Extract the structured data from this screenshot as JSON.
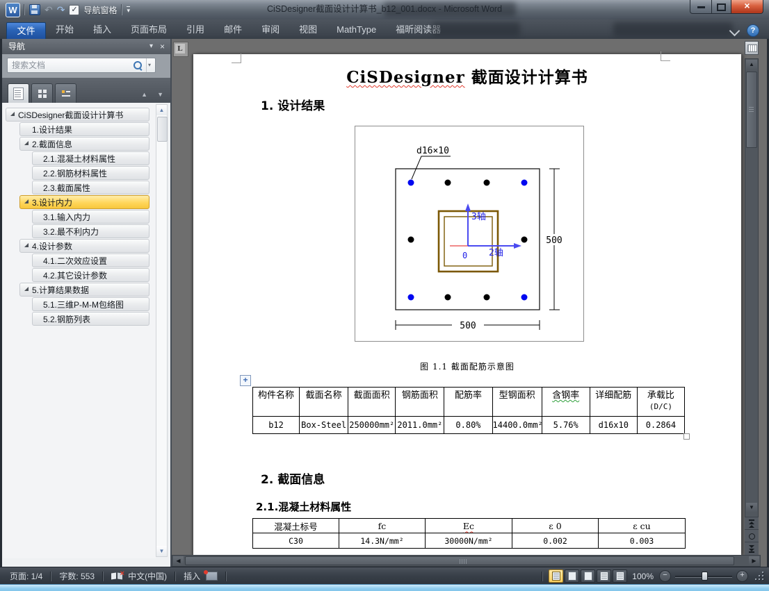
{
  "window": {
    "title": "CiSDesigner截面设计计算书_b12_001.docx  -  Microsoft Word",
    "qat_nav_checkbox_label": "导航窗格",
    "tabs": [
      "文件",
      "开始",
      "插入",
      "页面布局",
      "引用",
      "邮件",
      "审阅",
      "视图",
      "MathType",
      "福昕阅读器"
    ]
  },
  "icons": {
    "logo": "W",
    "undo": "↶",
    "redo": "↷",
    "checkbox_check": "✓",
    "qat_dropdown": "▾",
    "help": "?",
    "close": "×",
    "nav_dropdown": "▾",
    "nav_close": "×",
    "search_dropdown": "▾",
    "scroll_up": "▲",
    "scroll_down": "▼",
    "scroll_left": "◀",
    "scroll_right": "▶",
    "tab_selector": "L",
    "table_move": "+",
    "zoom_out": "−",
    "zoom_in": "+"
  },
  "nav": {
    "title": "导航",
    "search_placeholder": "搜索文档",
    "items": [
      {
        "label": "CiSDesigner截面设计计算书"
      },
      {
        "label": "1.设计结果"
      },
      {
        "label": "2.截面信息"
      },
      {
        "label": "2.1.混凝土材料属性"
      },
      {
        "label": "2.2.钢筋材料属性"
      },
      {
        "label": "2.3.截面属性"
      },
      {
        "label": "3.设计内力"
      },
      {
        "label": "3.1.输入内力"
      },
      {
        "label": "3.2.最不利内力"
      },
      {
        "label": "4.设计参数"
      },
      {
        "label": "4.1.二次效应设置"
      },
      {
        "label": "4.2.其它设计参数"
      },
      {
        "label": "5.计算结果数据"
      },
      {
        "label": "5.1.三维P-M-M包络图"
      },
      {
        "label": "5.2.钢筋列表"
      }
    ]
  },
  "document": {
    "title_en": "CiSDesigner",
    "title_cn": " 截面设计计算书",
    "section1": "1. 设计结果",
    "figure": {
      "rebar_label": "d16×10",
      "axis_vertical": "3轴",
      "axis_horizontal": "2轴",
      "origin": "0",
      "dim_right": "500",
      "dim_bottom": "500",
      "caption": "图 1.1 截面配筋示意图"
    },
    "table1": {
      "headers": [
        "构件名称",
        "截面名称",
        "截面面积",
        "钢筋面积",
        "配筋率",
        "型钢面积",
        "含钢率",
        "详细配筋",
        "承载比"
      ],
      "header9_sub": "(D/C)",
      "row": [
        "b12",
        "Box-Steel",
        "250000mm²",
        "2011.0mm²",
        "0.80%",
        "14400.0mm²",
        "5.76%",
        "d16x10",
        "0.2864"
      ]
    },
    "section2": "2. 截面信息",
    "section2_1": "2.1.混凝土材料属性",
    "table2": {
      "headers": [
        "混凝土标号",
        "fc",
        "Ec",
        "ε 0",
        "ε cu"
      ],
      "row": [
        "C30",
        "14.3N/mm²",
        "30000N/mm²",
        "0.002",
        "0.003"
      ]
    }
  },
  "status": {
    "page": "页面: 1/4",
    "words": "字数: 553",
    "language": "中文(中国)",
    "insert_mode": "插入",
    "zoom_level": "100%"
  },
  "colors": {
    "active_nav_item": "#FFD65B",
    "file_tab_blue": "#2A63B6",
    "close_button_red": "#C8442C",
    "rebar_corner_blue": "#0008F0",
    "rebar_middle_black": "#000000",
    "steel_box_brown": "#7B5804",
    "axis_blue": "#3A3AF0"
  }
}
